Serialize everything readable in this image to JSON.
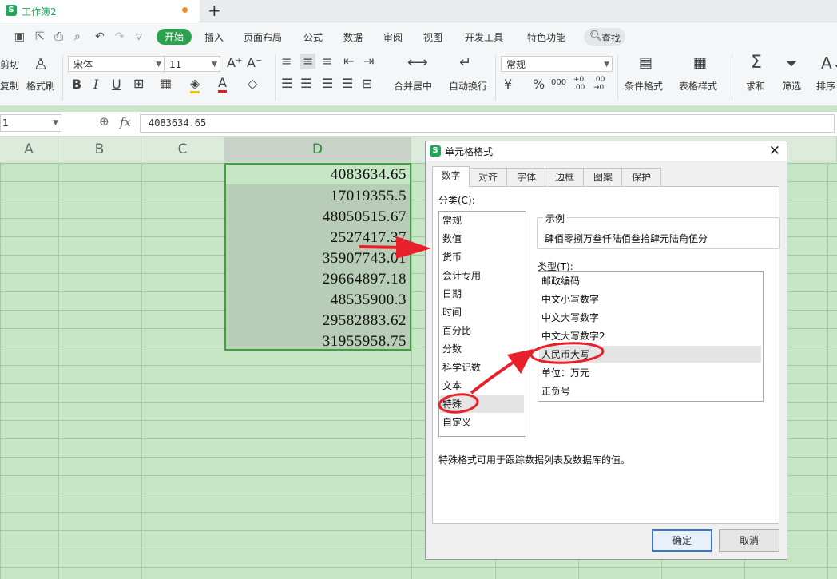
{
  "tabbar": {
    "doc_title": "工作簿2",
    "logo": "S",
    "new_tab": "+"
  },
  "menu": {
    "items": [
      "开始",
      "插入",
      "页面布局",
      "公式",
      "数据",
      "审阅",
      "视图",
      "开发工具",
      "特色功能"
    ],
    "search": "查找"
  },
  "ribbon": {
    "cut": "剪切",
    "copy": "复制",
    "format_painter": "格式刷",
    "font_name": "宋体",
    "font_size": "11",
    "merge_center": "合并居中",
    "wrap_text": "自动换行",
    "number_format": "常规",
    "conditional_format": "条件格式",
    "table_style": "表格样式",
    "sum": "求和",
    "filter": "筛选",
    "sort": "排序",
    "currency_symbol": "¥",
    "percent_symbol": "%",
    "thousands_symbol": "000",
    "dec_increase": "+0 .00",
    "dec_decrease": ".00 →0"
  },
  "formula": {
    "name_box": "1",
    "fx": "fx",
    "value": "4083634.65"
  },
  "columns": [
    "A",
    "B",
    "C",
    "D"
  ],
  "cells": [
    "4083634.65",
    "17019355.5",
    "48050515.67",
    "2527417.37",
    "35907743.01",
    "29664897.18",
    "48535900.3",
    "29582883.62",
    "31955958.75"
  ],
  "dialog": {
    "title": "单元格格式",
    "logo": "S",
    "close": "✕",
    "tabs": [
      "数字",
      "对齐",
      "字体",
      "边框",
      "图案",
      "保护"
    ],
    "category_label": "分类(C):",
    "categories": [
      "常规",
      "数值",
      "货币",
      "会计专用",
      "日期",
      "时间",
      "百分比",
      "分数",
      "科学记数",
      "文本",
      "特殊",
      "自定义"
    ],
    "selected_category": "特殊",
    "sample_label": "示例",
    "sample_value": "肆佰零捌万叁仟陆佰叁拾肆元陆角伍分",
    "type_label": "类型(T):",
    "types": [
      "邮政编码",
      "中文小写数字",
      "中文大写数字",
      "中文大写数字2",
      "人民币大写",
      "单位：万元",
      "正负号"
    ],
    "selected_type": "人民币大写",
    "description": "特殊格式可用于跟踪数据列表及数据库的值。",
    "ok": "确定",
    "cancel": "取消"
  },
  "colors": {
    "accent": "#2da14f",
    "annotation": "#e8202a",
    "grid": "#c6e6c6",
    "selection": "#3fa03f"
  }
}
